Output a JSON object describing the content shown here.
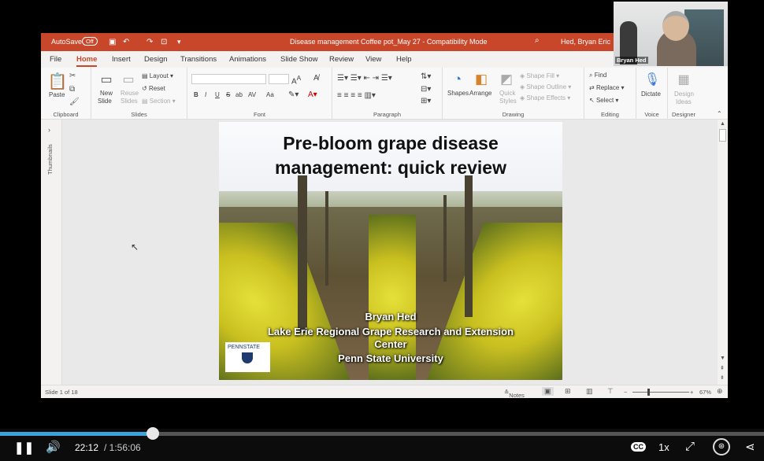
{
  "titlebar": {
    "autosave_label": "AutoSave",
    "autosave_state": "Off",
    "doc_title": "Disease management Coffee pot_May 27  -  Compatibility Mode",
    "user": "Hed, Bryan Eric"
  },
  "tabs": [
    "File",
    "Home",
    "Insert",
    "Design",
    "Transitions",
    "Animations",
    "Slide Show",
    "Review",
    "View",
    "Help"
  ],
  "ribbon": {
    "clipboard": {
      "paste": "Paste",
      "label": "Clipboard"
    },
    "slides": {
      "new_slide": "New",
      "new_slide2": "Slide",
      "reuse": "Reuse",
      "reuse2": "Slides",
      "layout": "Layout",
      "reset": "Reset",
      "section": "Section",
      "label": "Slides"
    },
    "font": {
      "label": "Font",
      "buttons": [
        "B",
        "I",
        "U",
        "S",
        "ab",
        "AV",
        "Aa"
      ]
    },
    "paragraph": {
      "label": "Paragraph"
    },
    "drawing": {
      "shapes": "Shapes",
      "arrange": "Arrange",
      "quick": "Quick",
      "styles": "Styles",
      "shape_fill": "Shape Fill",
      "shape_outline": "Shape Outline",
      "shape_effects": "Shape Effects",
      "label": "Drawing"
    },
    "editing": {
      "find": "Find",
      "replace": "Replace",
      "select": "Select",
      "label": "Editing"
    },
    "voice": {
      "dictate": "Dictate",
      "label": "Voice"
    },
    "designer": {
      "design": "Design",
      "ideas": "Ideas",
      "label": "Designer"
    }
  },
  "thumbnails_label": "Thumbnails",
  "slide": {
    "title_line1": "Pre-bloom grape disease",
    "title_line2": "management: quick review",
    "author": "Bryan Hed",
    "org_line1": "Lake Erie Regional Grape Research and Extension",
    "org_line2": "Center",
    "university": "Penn State University",
    "logo_text": "PENNSTATE"
  },
  "status": {
    "slide_count": "Slide 1 of 18",
    "notes": "Notes",
    "zoom": "67%"
  },
  "webcam": {
    "name": "Bryan Hed"
  },
  "player": {
    "current_time": "22:12",
    "total_time": "/ 1:56:06",
    "speed": "1x",
    "cc": "CC",
    "progress_fraction": 0.2
  }
}
